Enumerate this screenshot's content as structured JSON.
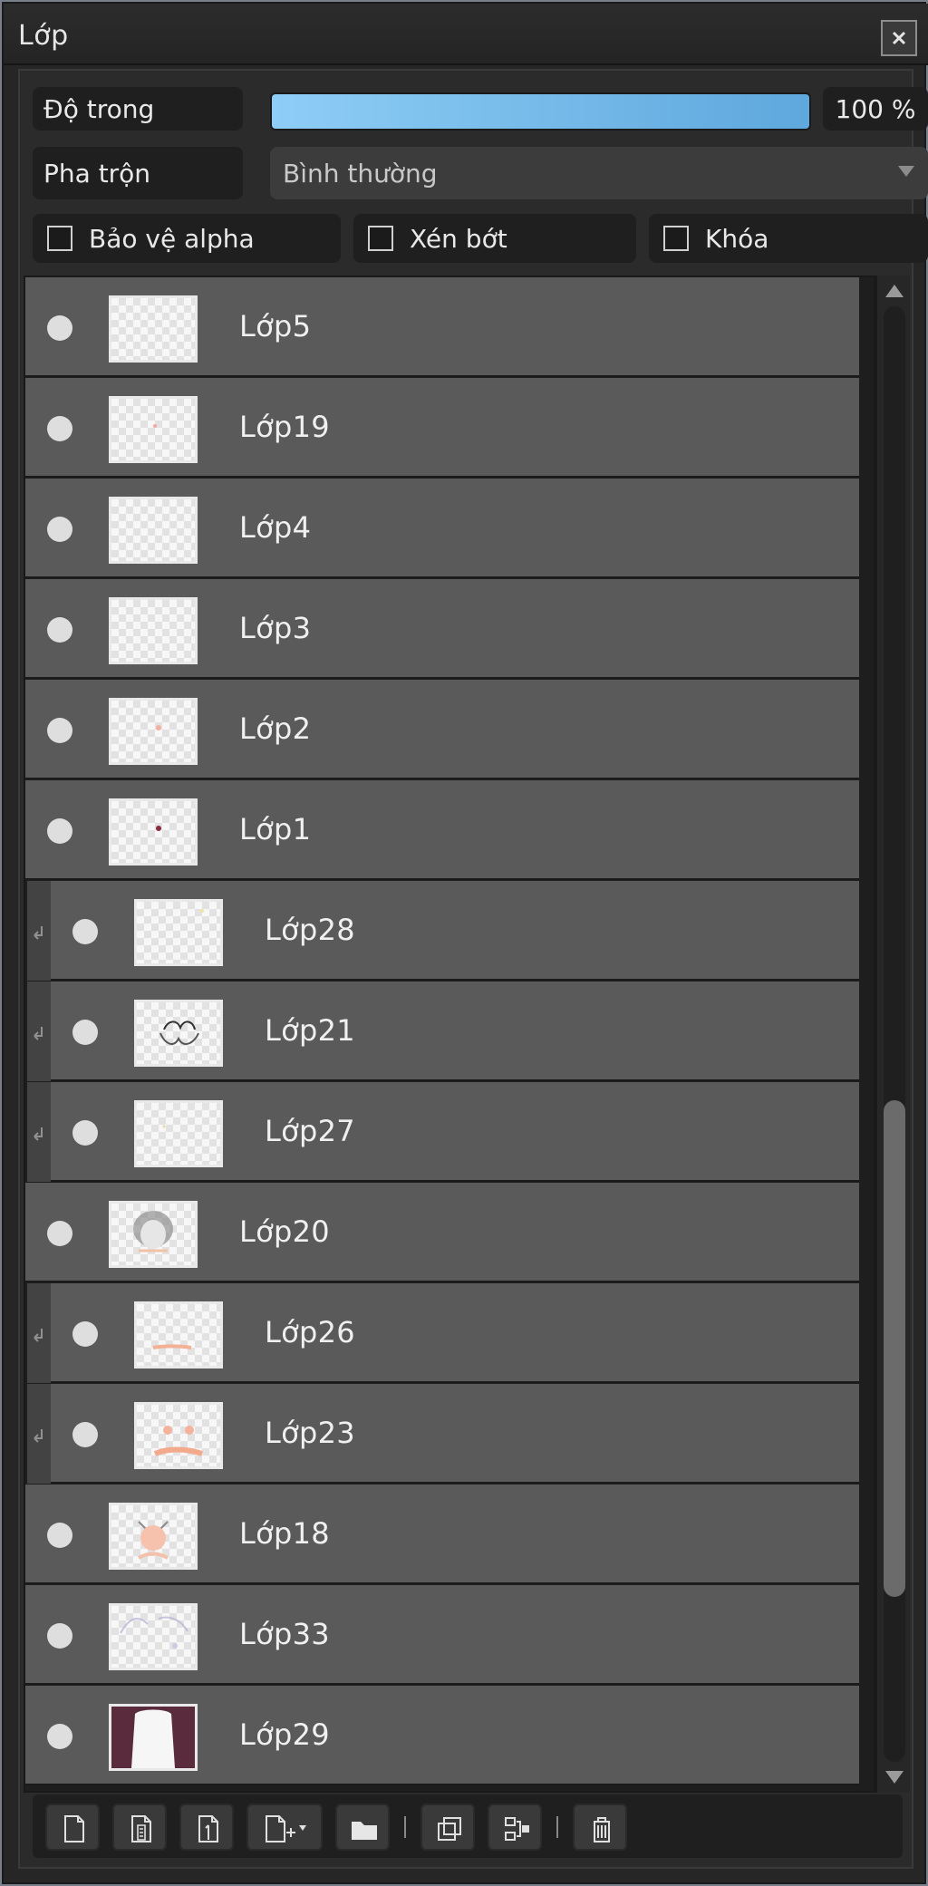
{
  "window": {
    "title": "Lớp"
  },
  "controls": {
    "opacity": {
      "label": "Độ trong",
      "value_text": "100 %",
      "fill_percent": 100
    },
    "blend": {
      "label": "Pha trộn",
      "selected": "Bình thường"
    },
    "checkboxes": {
      "alpha": "Bảo vệ alpha",
      "clip": "Xén bớt",
      "lock": "Khóa"
    }
  },
  "layers": [
    {
      "name": "Lớp5"
    },
    {
      "name": "Lớp19"
    },
    {
      "name": "Lớp4"
    },
    {
      "name": "Lớp3"
    },
    {
      "name": "Lớp2"
    },
    {
      "name": "Lớp1"
    },
    {
      "name": "Lớp28"
    },
    {
      "name": "Lớp21"
    },
    {
      "name": "Lớp27"
    },
    {
      "name": "Lớp20"
    },
    {
      "name": "Lớp26"
    },
    {
      "name": "Lớp23"
    },
    {
      "name": "Lớp18"
    },
    {
      "name": "Lớp33"
    },
    {
      "name": "Lớp29"
    }
  ],
  "colors": {
    "accent_bar_start": "#8ecdf6",
    "accent_bar_end": "#5ea8dd",
    "row_bg": "#5a5a5a",
    "thumb_border": "#e9e9e9"
  },
  "toolbar": {
    "icons": [
      "new-layer-icon",
      "new-8bit-layer-icon",
      "new-1bit-layer-icon",
      "add-layer-dropdown-icon",
      "folder-icon",
      "duplicate-layer-icon",
      "merge-layer-icon",
      "delete-layer-icon"
    ]
  }
}
